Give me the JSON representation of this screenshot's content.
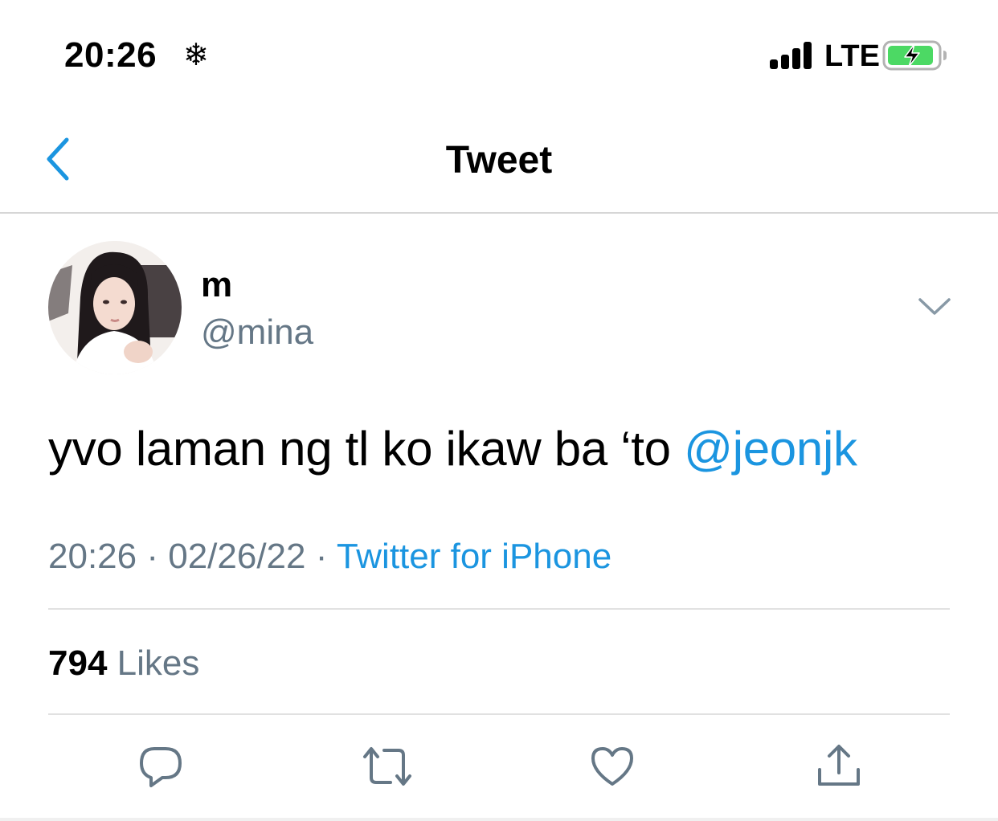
{
  "status_bar": {
    "time": "20:26",
    "extra_icon": "snowflake-icon",
    "network": "LTE",
    "signal_icon": "cellular-signal-icon",
    "battery_icon": "battery-charging-icon",
    "battery_color": "#4cd964"
  },
  "nav": {
    "back_icon": "chevron-left-icon",
    "title": "Tweet"
  },
  "tweet": {
    "avatar_icon": "avatar",
    "display_name": "m",
    "handle": "@mina",
    "text_before": "yvo laman ng tl ko ikaw ba ‘to ",
    "mention": "@jeonjk",
    "time": "20:26",
    "separator": " · ",
    "date": "02/26/22",
    "source": "Twitter for iPhone",
    "likes_count": "794",
    "likes_label": "Likes"
  },
  "actions": [
    {
      "icon": "reply-icon"
    },
    {
      "icon": "retweet-icon"
    },
    {
      "icon": "like-icon"
    },
    {
      "icon": "share-icon"
    }
  ],
  "colors": {
    "accent": "#1b95e0",
    "secondary_text": "#657786",
    "icon_gray": "#657786"
  }
}
